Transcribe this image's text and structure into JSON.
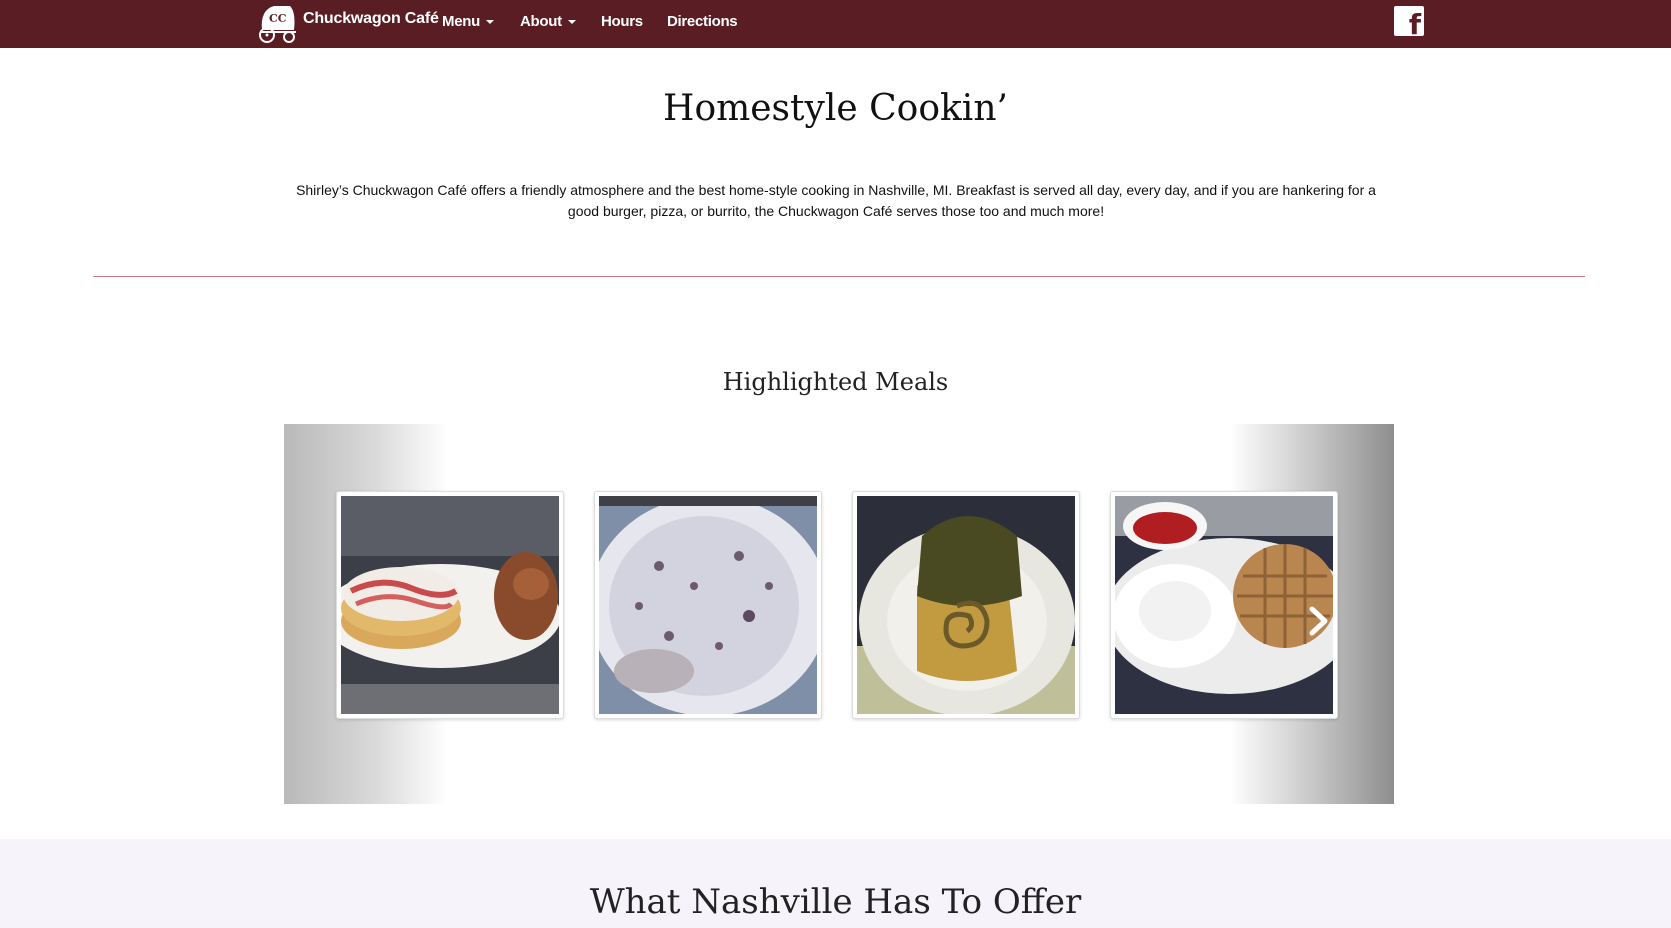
{
  "nav": {
    "brand_name": "Chuckwagon Café",
    "items": [
      {
        "label": "Menu",
        "dropdown": true
      },
      {
        "label": "About",
        "dropdown": true
      },
      {
        "label": "Hours",
        "dropdown": false
      },
      {
        "label": "Directions",
        "dropdown": false
      }
    ],
    "social_icon": "facebook-icon",
    "logo_text": "CC"
  },
  "colors": {
    "navbar": "#5b1d24",
    "divider": "#c9808a",
    "offer_band": "#f7f3fb"
  },
  "hero": {
    "title": "Homestyle Cookin’",
    "intro": "Shirley’s Chuckwagon Café offers a friendly atmosphere and the best home-style cooking in Nashville, MI. Breakfast is served all day, every day, and if you are hankering for a good burger, pizza, or burrito, the Chuckwagon Café serves those too and much more!"
  },
  "meals": {
    "title": "Highlighted Meals",
    "next_icon": "chevron-right-icon"
  },
  "offer": {
    "title": "What Nashville Has To Offer"
  }
}
